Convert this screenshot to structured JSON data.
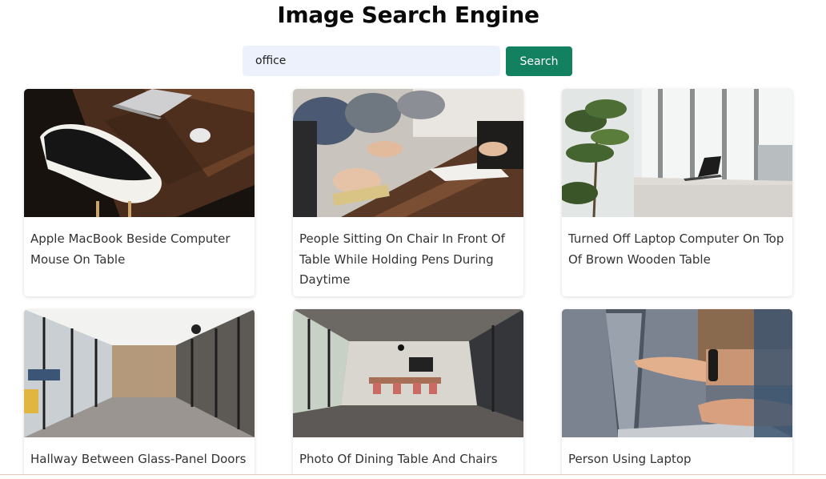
{
  "header": {
    "title": "Image Search Engine"
  },
  "search": {
    "value": "office",
    "placeholder": "",
    "button_label": "Search"
  },
  "results": [
    {
      "caption": "Apple MacBook Beside Computer Mouse On Table"
    },
    {
      "caption": "People Sitting On Chair In Front Of Table While Holding Pens During Daytime"
    },
    {
      "caption": "Turned Off Laptop Computer On Top Of Brown Wooden Table"
    },
    {
      "caption": "Hallway Between Glass-Panel Doors"
    },
    {
      "caption": "Photo Of Dining Table And Chairs Inside Room"
    },
    {
      "caption": "Person Using Laptop"
    }
  ]
}
